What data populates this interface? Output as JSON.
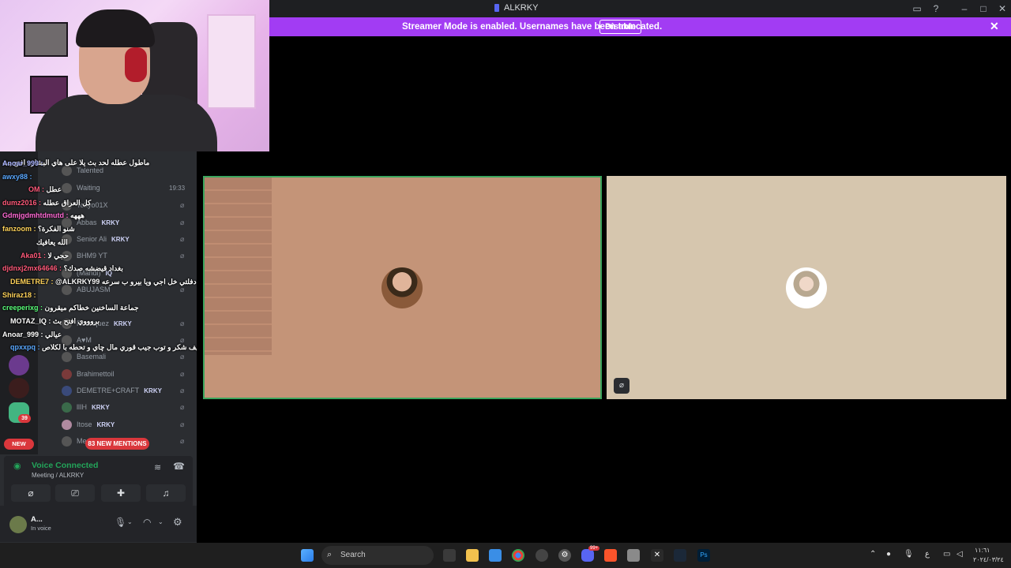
{
  "window": {
    "title": "ALKRKY"
  },
  "banner": {
    "text": "Streamer Mode is enabled. Usernames have been truncated.",
    "disable_label": "Disable"
  },
  "members": [
    {
      "name": "Talented",
      "tag": ""
    },
    {
      "name": "Waiting",
      "tag": "",
      "time": "19:33"
    },
    {
      "name": "Tokyo01X",
      "tag": ""
    },
    {
      "name": "Abbas",
      "tag": "KRKY"
    },
    {
      "name": "Senior Ali",
      "tag": "KRKY"
    },
    {
      "name": "BHM9 YT",
      "tag": ""
    },
    {
      "name": "(Mahdi)",
      "tag": "IQ"
    },
    {
      "name": "ABUJASM",
      "tag": ""
    },
    {
      "name": "Rodriquez",
      "tag": "KRKY"
    },
    {
      "name": "A♥M",
      "tag": ""
    },
    {
      "name": "Basemali",
      "tag": ""
    },
    {
      "name": "Brahimettoil",
      "tag": ""
    },
    {
      "name": "DEMETRE+CRAFT",
      "tag": "KRKY"
    },
    {
      "name": "llIH",
      "tag": "KRKY"
    },
    {
      "name": "Itose",
      "tag": "KRKY"
    },
    {
      "name": "Me",
      "tag": ""
    }
  ],
  "chat": [
    {
      "user": "",
      "text": "ماطول عطله لحد بث يلا على هاي البشاره افتح بث"
    },
    {
      "user": "Anoar_999 :",
      "text": ""
    },
    {
      "user": "awxy88 :",
      "text": ""
    },
    {
      "user": "OM :",
      "text": "عطل"
    },
    {
      "user": "dumz2016 :",
      "text": "كل العراق عطله"
    },
    {
      "user": "Gdmjgdmhtdmutd :",
      "text": "هههه"
    },
    {
      "user": "fanzoom :",
      "text": "شنو الفكرة؟"
    },
    {
      "user": "",
      "text": "الله يعافيك"
    },
    {
      "user": "Aka01 :",
      "text": "حجي لا"
    },
    {
      "user": "djdnxj2mx64646 :",
      "text": "بغداد قيضشه صدك؟"
    },
    {
      "user": "DEMETRE7 :",
      "text": "@ALKRKY99 سلاو دفلتي خل اجي ويا بيرو ب سرعه"
    },
    {
      "user": "Shiraz18 :",
      "text": ""
    },
    {
      "user": "creeperixg :",
      "text": "جماعة الساخنين خطاكم ميقرون"
    },
    {
      "user": "MOTAZ_IQ :",
      "text": "بروووي افتح بث"
    },
    {
      "user": "Anoar_999 :",
      "text": "عيالي"
    },
    {
      "user": "qpxxpq :",
      "text": "هوه ضيف شكر و توب جيب قوري مال چاي و تحطه با لكلاص"
    }
  ],
  "mentions": {
    "label": "83 NEW MENTIONS",
    "new_label": "NEW",
    "badge_count": "39"
  },
  "voice": {
    "status": "Voice Connected",
    "channel": "Meeting / ALKRKY"
  },
  "user": {
    "name": "A...",
    "status": "In voice"
  },
  "taskbar": {
    "search_placeholder": "Search",
    "discord_badge": "99+",
    "clock_time": "١١:٦١",
    "clock_date": "٢٠٢٤/٠٣/٢٤",
    "language": "ع"
  },
  "colors": {
    "banner": "#a23cf3",
    "speaking_border": "#3ba55d",
    "mention_red": "#da373c"
  }
}
